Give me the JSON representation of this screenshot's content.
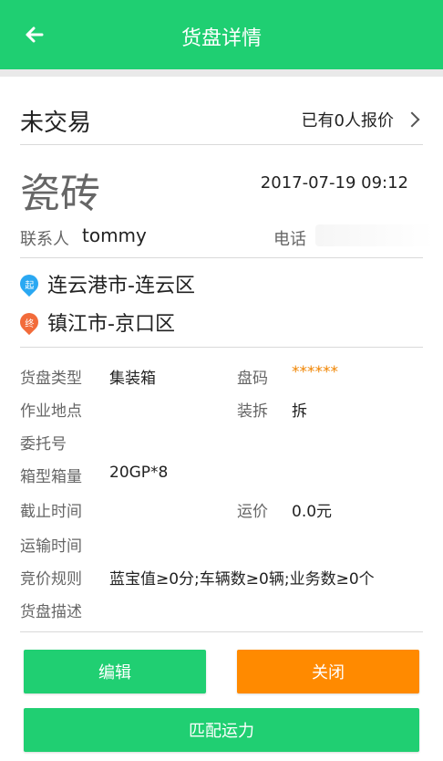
{
  "header": {
    "title": "货盘详情"
  },
  "summary": {
    "status": "未交易",
    "quotes": "已有0人报价"
  },
  "goods": {
    "name": "瓷砖",
    "date": "2017-07-19 09:12"
  },
  "contact": {
    "label": "联系人",
    "name": "tommy",
    "phone_label": "电话"
  },
  "route": {
    "start": {
      "badge": "起",
      "text": "连云港市-连云区"
    },
    "end": {
      "badge": "终",
      "text": "镇江市-京口区"
    }
  },
  "details": {
    "type_label": "货盘类型",
    "type_value": "集装箱",
    "code_label": "盘码",
    "code_value": "******",
    "site_label": "作业地点",
    "site_value": "",
    "unpack_label": "装拆",
    "unpack_value": "拆",
    "consign_label": "委托号",
    "consign_value": "",
    "box_label": "箱型箱量",
    "box_value": "20GP*8",
    "deadline_label": "截止时间",
    "deadline_value": "",
    "price_label": "运价",
    "price_value": "0.0元",
    "transport_label": "运输时间",
    "transport_value": "",
    "bid_label": "竞价规则",
    "bid_value": "蓝宝值≥0分;车辆数≥0辆;业务数≥0个",
    "desc_label": "货盘描述",
    "desc_value": ""
  },
  "actions": {
    "edit": "编辑",
    "close": "关闭",
    "match": "匹配运力"
  },
  "colors": {
    "primary": "#1fcf72",
    "accent": "#ff8a00"
  }
}
